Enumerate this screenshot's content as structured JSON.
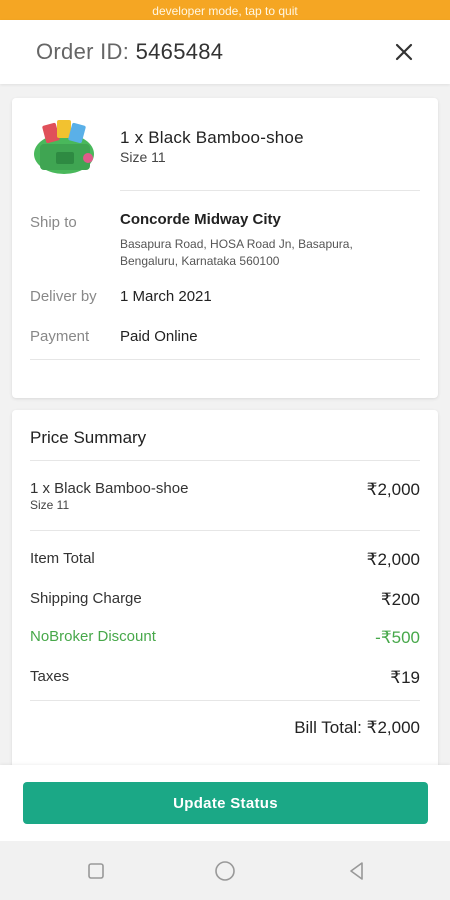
{
  "status_banner": "developer mode, tap to quit",
  "header": {
    "order_label": "Order ID:",
    "order_id": "5465484"
  },
  "order": {
    "product_title": "1 x Black Bamboo-shoe",
    "product_size": "Size 11",
    "ship_to_label": "Ship to",
    "ship_to_name": "Concorde Midway City",
    "ship_to_address_line1": "Basapura Road, HOSA Road Jn, Basapura,",
    "ship_to_address_line2": "Bengaluru, Karnataka 560100",
    "deliver_by_label": "Deliver by",
    "deliver_by_value": "1 March 2021",
    "payment_label": "Payment",
    "payment_value": "Paid Online"
  },
  "price_summary": {
    "title": "Price Summary",
    "item_title": "1 x Black Bamboo-shoe",
    "item_size": "Size 11",
    "item_price": "₹2,000",
    "rows": [
      {
        "label": "Item Total",
        "amount": "₹2,000"
      },
      {
        "label": "Shipping Charge",
        "amount": "₹200"
      },
      {
        "label": "NoBroker Discount",
        "amount": "-₹500"
      },
      {
        "label": "Taxes",
        "amount": "₹19"
      }
    ],
    "bill_total_label": "Bill Total:",
    "bill_total_value": "₹2,000"
  },
  "actions": {
    "update_status": "Update Status"
  },
  "colors": {
    "banner": "#f5a623",
    "primary": "#1ba886",
    "discount": "#47a84a"
  },
  "icons": {
    "close": "close-icon",
    "nav_recent": "square-icon",
    "nav_home": "circle-icon",
    "nav_back": "triangle-back-icon"
  }
}
